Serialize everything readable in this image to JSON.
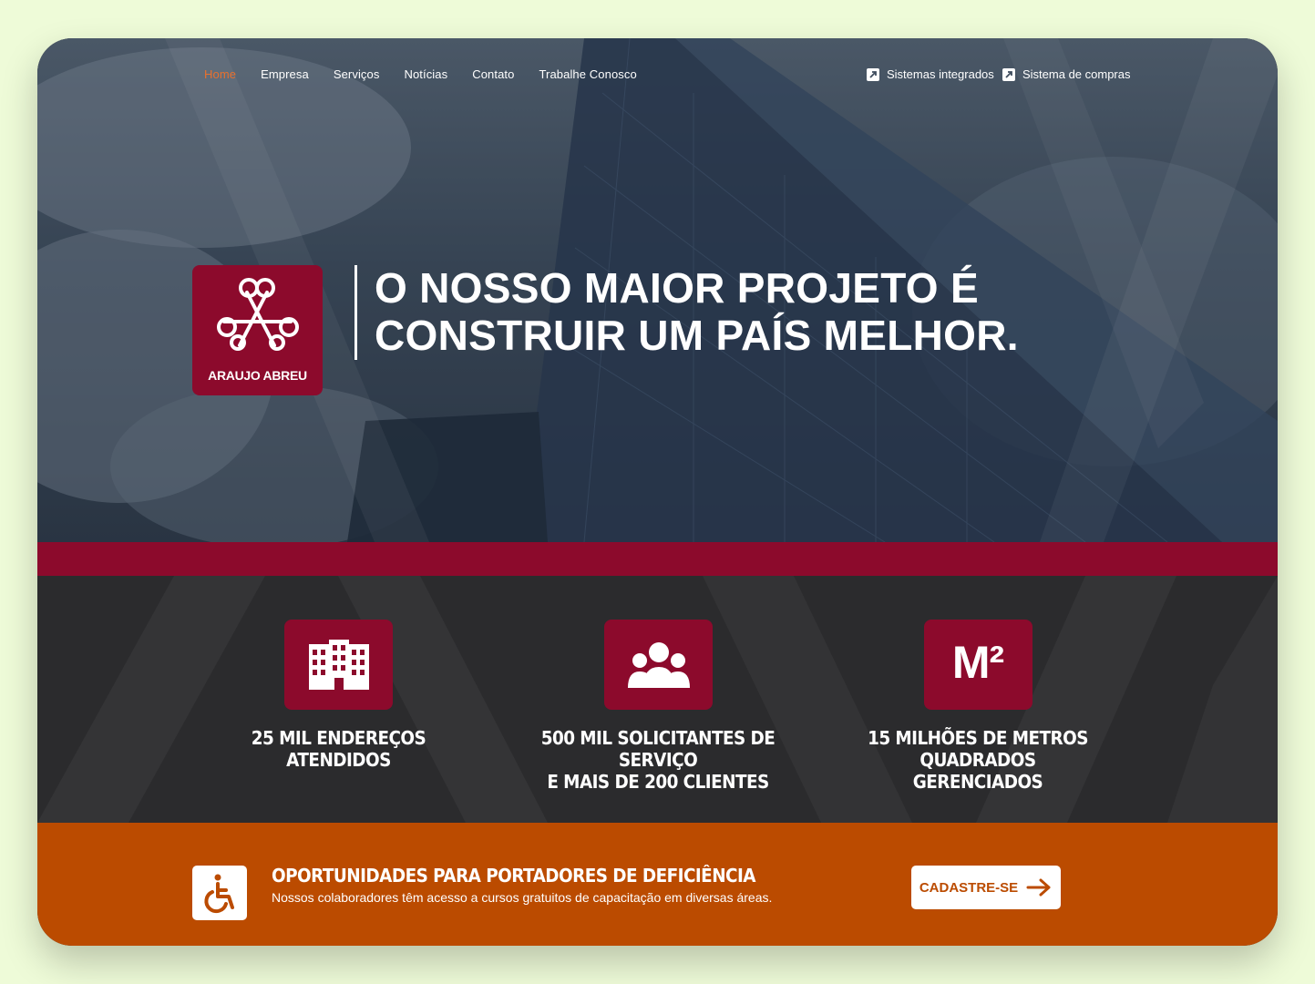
{
  "nav": {
    "items": [
      {
        "label": "Home",
        "active": true
      },
      {
        "label": "Empresa",
        "active": false
      },
      {
        "label": "Serviços",
        "active": false
      },
      {
        "label": "Notícias",
        "active": false
      },
      {
        "label": "Contato",
        "active": false
      },
      {
        "label": "Trabalhe Conosco",
        "active": false
      }
    ],
    "external": [
      {
        "label": "Sistemas integrados",
        "icon": "external-link-icon"
      },
      {
        "label": "Sistema de compras",
        "icon": "external-link-icon"
      }
    ]
  },
  "hero": {
    "logo_text": "ARAUJO ABREU",
    "headline_line1": "O NOSSO MAIOR PROJETO É",
    "headline_line2": "CONSTRUIR UM PAÍS MELHOR."
  },
  "stats": [
    {
      "icon": "building-icon",
      "line1": "25 MIL ENDEREÇOS ATENDIDOS",
      "line2": ""
    },
    {
      "icon": "people-icon",
      "line1": "500 MIL SOLICITANTES DE SERVIÇO",
      "line2": "E MAIS DE 200 CLIENTES"
    },
    {
      "icon": "m2-icon",
      "icon_text": "M²",
      "line1": "15 MILHÕES DE METROS",
      "line2": "QUADRADOS GERENCIADOS"
    }
  ],
  "opportunity": {
    "icon": "wheelchair-icon",
    "title": "OPORTUNIDADES PARA PORTADORES DE DEFICIÊNCIA",
    "text": "Nossos colaboradores têm acesso a cursos gratuitos de capacitação em diversas áreas.",
    "cta_label": "CADASTRE-SE"
  },
  "colors": {
    "brand_red": "#8c0a2c",
    "accent_orange": "#bb4b00",
    "nav_active": "#e8702e",
    "dark": "#2b2b2d",
    "page_bg": "#eefbd8"
  }
}
